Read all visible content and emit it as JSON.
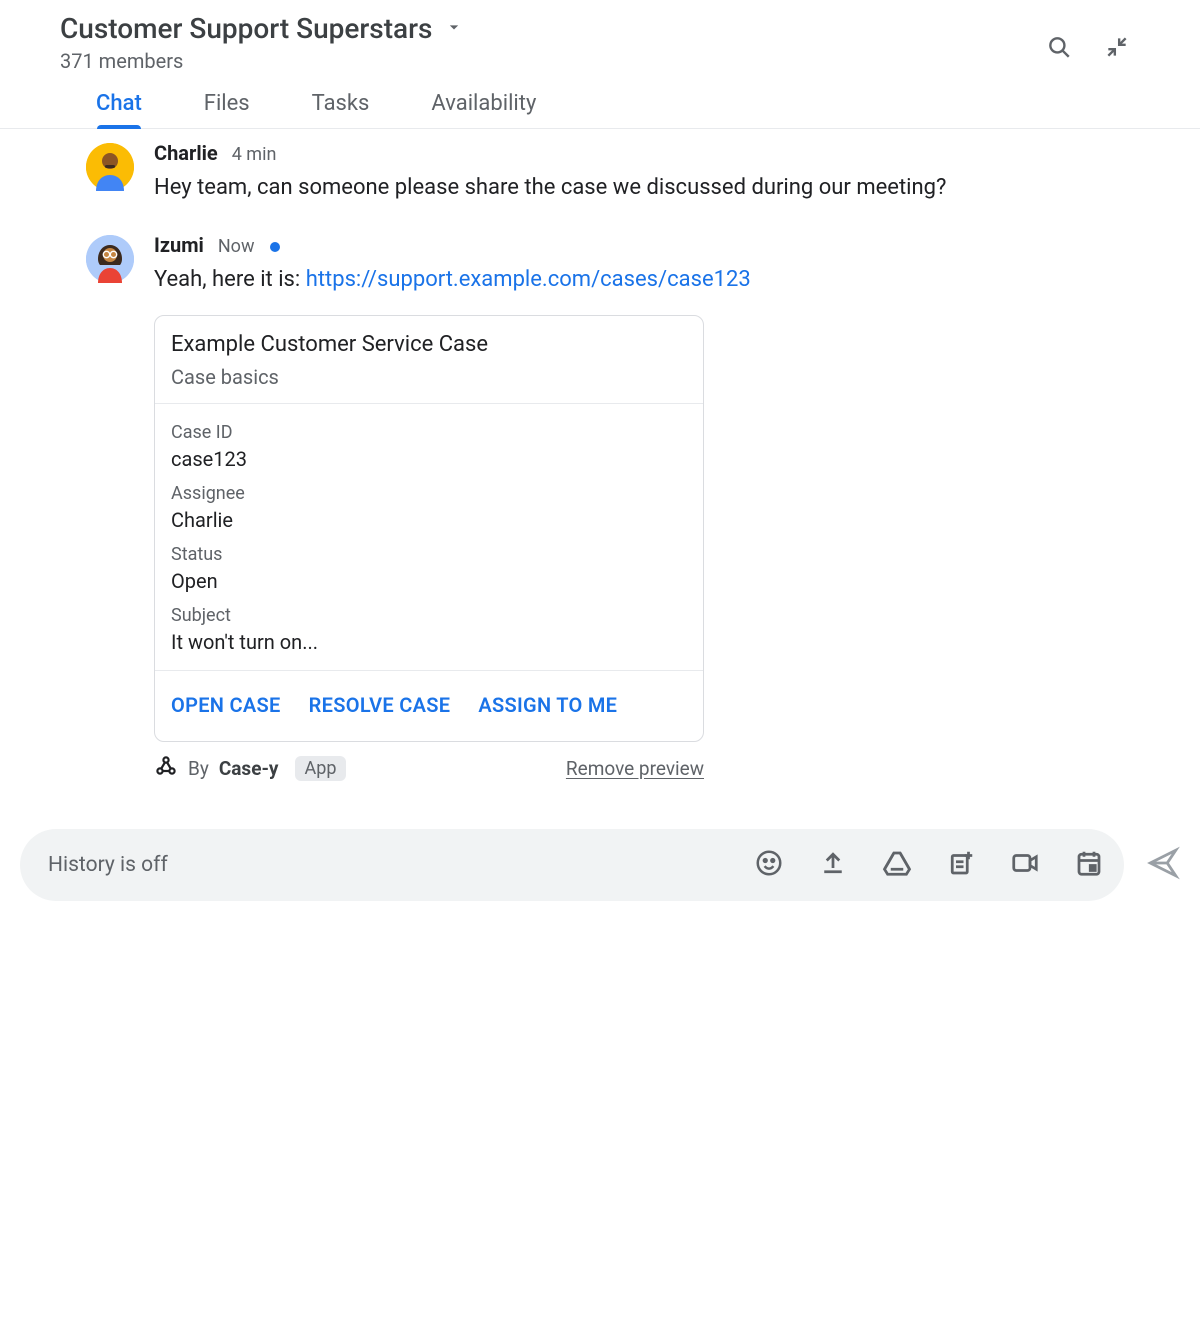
{
  "header": {
    "space_title": "Customer Support Superstars",
    "member_count": "371 members"
  },
  "tabs": {
    "items": [
      "Chat",
      "Files",
      "Tasks",
      "Availability"
    ],
    "active_index": 0
  },
  "messages": [
    {
      "author": "Charlie",
      "time": "4 min",
      "text": "Hey team, can someone please share the case we discussed during our meeting?"
    },
    {
      "author": "Izumi",
      "time": "Now",
      "is_new": true,
      "text_prefix": "Yeah, here it is: ",
      "link": "https://support.example.com/cases/case123"
    }
  ],
  "card": {
    "title": "Example Customer Service Case",
    "subtitle": "Case basics",
    "fields": [
      {
        "label": "Case ID",
        "value": "case123"
      },
      {
        "label": "Assignee",
        "value": "Charlie"
      },
      {
        "label": "Status",
        "value": "Open"
      },
      {
        "label": "Subject",
        "value": "It won't turn on..."
      }
    ],
    "actions": [
      "OPEN CASE",
      "RESOLVE CASE",
      "ASSIGN TO ME"
    ]
  },
  "attribution": {
    "by": "By",
    "app_name": "Case-y",
    "badge": "App",
    "remove": "Remove preview"
  },
  "composer": {
    "placeholder": "History is off"
  }
}
